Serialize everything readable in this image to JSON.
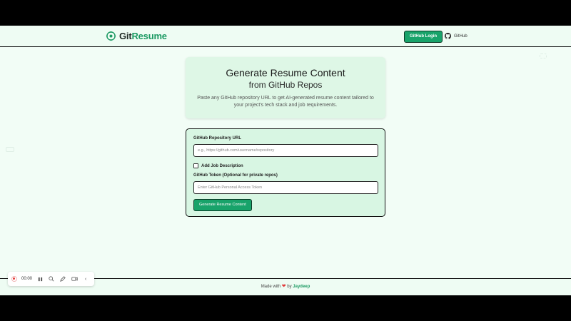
{
  "header": {
    "brand_part1": "Git",
    "brand_part2": "Resume",
    "login_label": "GitHub Login",
    "github_link_label": "GitHub"
  },
  "hero": {
    "title": "Generate Resume Content",
    "subtitle": "from GitHub Repos",
    "description": "Paste any GitHub repository URL to get AI-generated resume content tailored to your project's tech stack and job requirements."
  },
  "form": {
    "repo_label": "GitHub Repository URL",
    "repo_placeholder": "e.g., https://github.com/username/repository",
    "repo_value": "",
    "job_desc_label": "Add Job Description",
    "job_desc_checked": false,
    "token_label": "GitHub Token (Optional for private repos)",
    "token_placeholder": "Enter GitHub Personal Access Token",
    "token_value": "",
    "generate_label": "Generate Resume Content"
  },
  "footer": {
    "made_with": "Made with",
    "by": "by",
    "author": "Jaydeep"
  },
  "recorder": {
    "time": "00:00",
    "icons": [
      "record-icon",
      "pause-icon",
      "zoom-icon",
      "pen-icon",
      "camera-icon",
      "collapse-icon"
    ]
  },
  "colors": {
    "accent": "#18a36a",
    "background": "#f2fdf6",
    "heart": "#e23b3b"
  }
}
